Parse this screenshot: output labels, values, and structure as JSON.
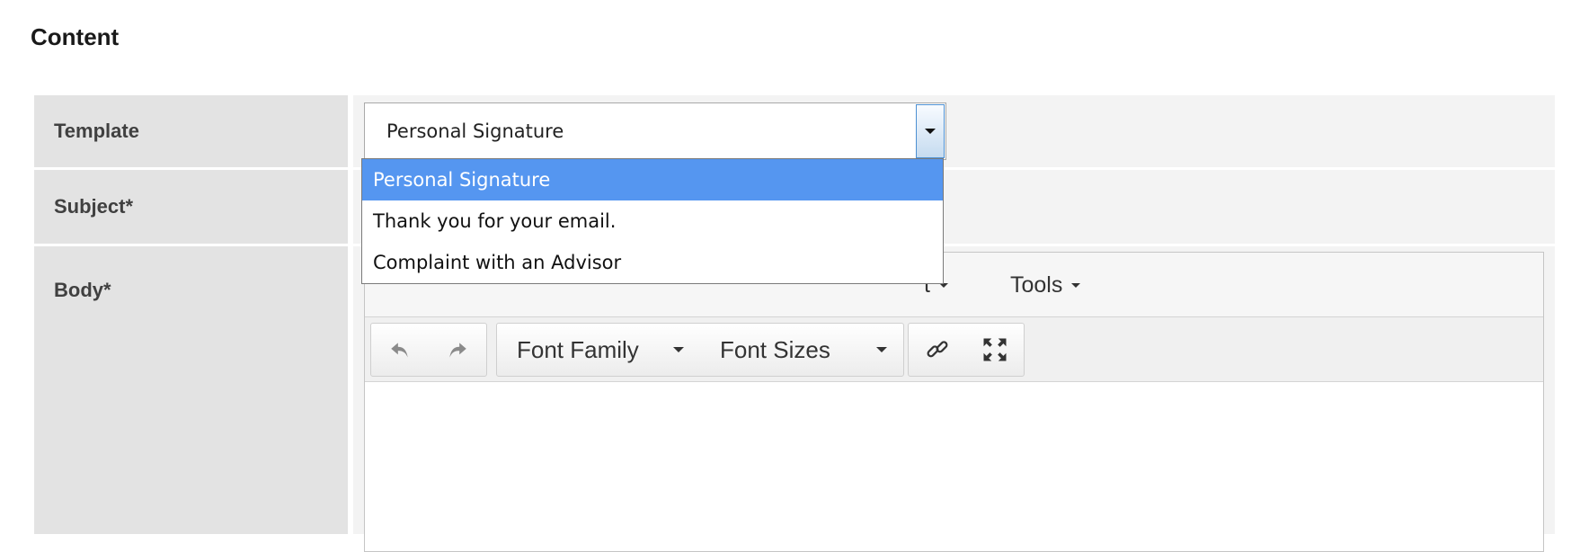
{
  "section": {
    "title": "Content"
  },
  "form": {
    "template": {
      "label": "Template",
      "selected": "Personal Signature",
      "options": [
        "Personal Signature",
        "Thank you for your email.",
        "Complaint with an Advisor"
      ]
    },
    "subject": {
      "label": "Subject*"
    },
    "body": {
      "label": "Body*"
    }
  },
  "editor": {
    "menubar": {
      "format_partial": "t",
      "tools": "Tools"
    },
    "toolbar": {
      "font_family": "Font Family",
      "font_sizes": "Font Sizes"
    }
  },
  "icons": [
    "chevron-down-icon",
    "undo-icon",
    "redo-icon",
    "link-icon",
    "fullscreen-icon"
  ],
  "colors": {
    "selected_option": "#5596f0",
    "label_bg": "#e3e3e3",
    "value_bg": "#f3f3f3"
  }
}
